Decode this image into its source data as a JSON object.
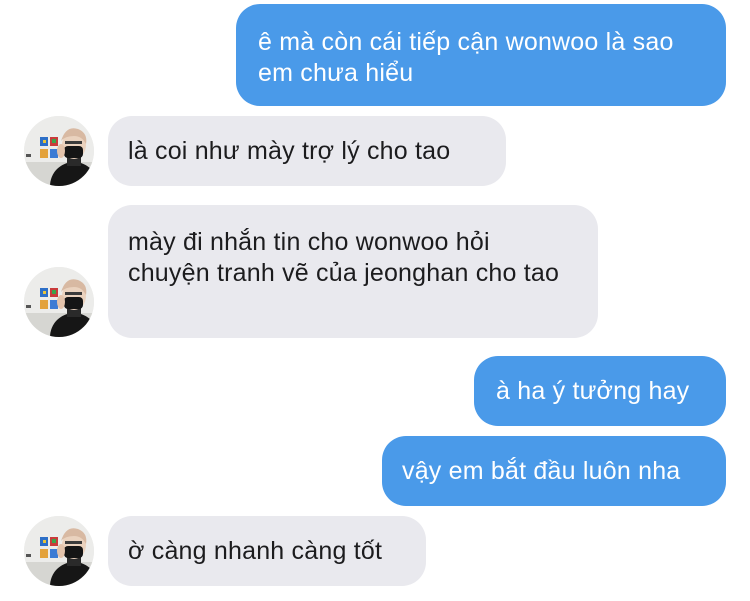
{
  "messages": [
    {
      "side": "sent",
      "text": "ê mà còn cái tiếp cận wonwoo là sao em chưa hiểu"
    },
    {
      "side": "received",
      "text": "là coi như mày trợ lý cho tao"
    },
    {
      "side": "received",
      "text": "mày đi nhắn tin cho wonwoo hỏi chuyện tranh vẽ của jeonghan cho tao"
    },
    {
      "side": "sent",
      "text": "à ha ý tưởng hay"
    },
    {
      "side": "sent",
      "text": "vậy em bắt đầu luôn nha"
    },
    {
      "side": "received",
      "text": "ờ càng nhanh càng tốt"
    }
  ],
  "colors": {
    "sent_bubble": "#4a9ae9",
    "received_bubble": "#e9e9ee",
    "sent_text": "#ffffff",
    "received_text": "#1c1c1e"
  },
  "icons": {
    "avatar": "contact-avatar-photo"
  }
}
